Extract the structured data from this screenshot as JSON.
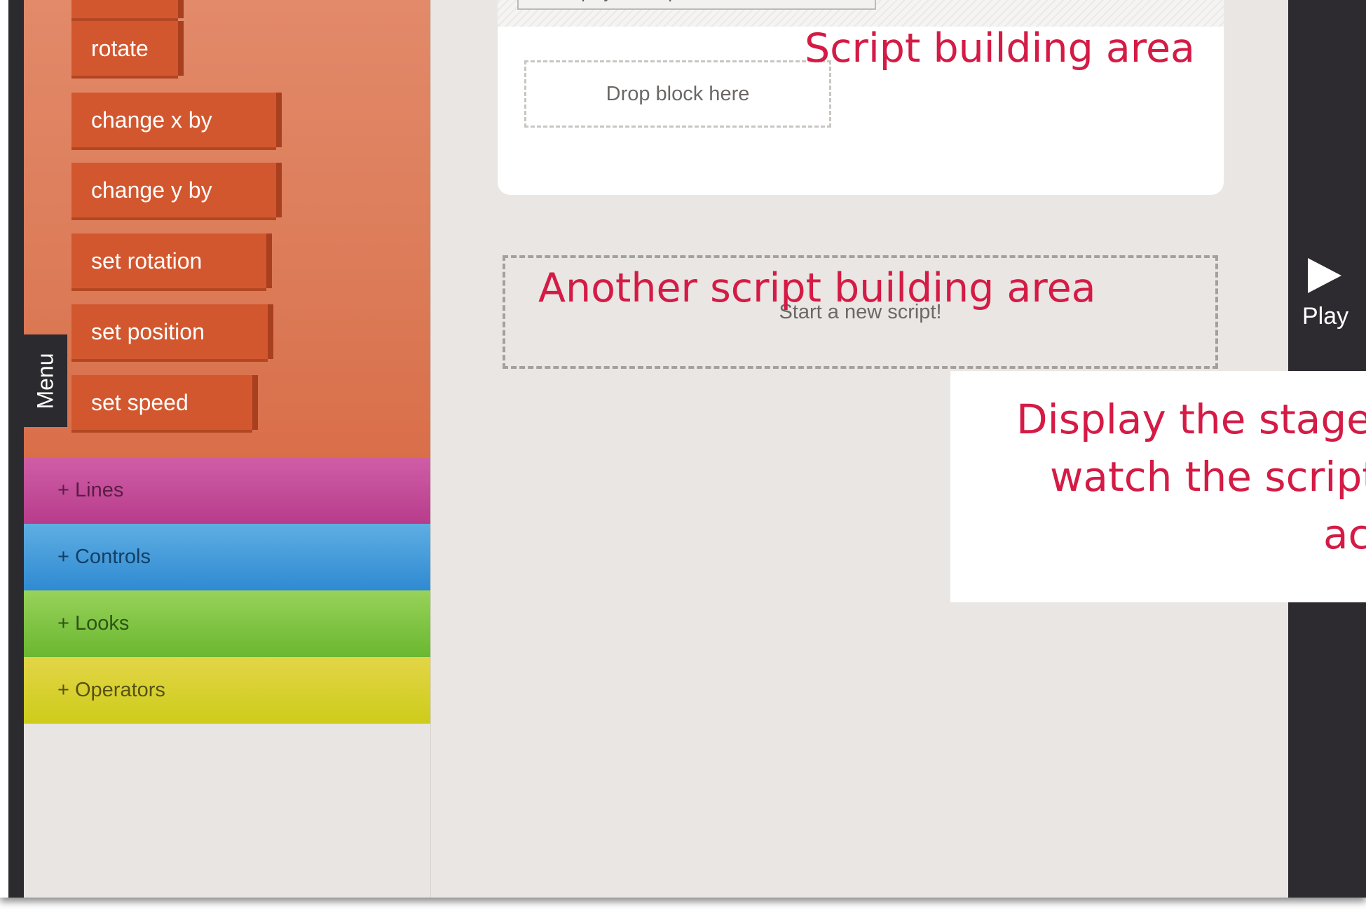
{
  "palette": {
    "motion_blocks": [
      "rotate",
      "change x by",
      "change y by",
      "set rotation",
      "set position",
      "set speed"
    ],
    "categories": {
      "lines": "+ Lines",
      "controls": "+ Controls",
      "looks": "+ Looks",
      "operators": "+ Operators"
    },
    "menu_tab": "Menu"
  },
  "workspace": {
    "hat_block": "When play button pressed",
    "drop_zone": "Drop block here",
    "new_script": "Start a new script!"
  },
  "stage": {
    "play_label": "Play",
    "play_icon": "play-triangle-icon"
  },
  "annotations": {
    "script_area": "Script building area",
    "another_area": "Another script building area",
    "stage_line1": "Display the stage a",
    "stage_line2": "watch the scripts",
    "stage_line3": "ac"
  },
  "colors": {
    "motion": "#d2572f",
    "lines": "#c2479a",
    "controls": "#3f98da",
    "looks": "#7cc23f",
    "operators": "#d8d02c",
    "annotation": "#d41b45"
  }
}
